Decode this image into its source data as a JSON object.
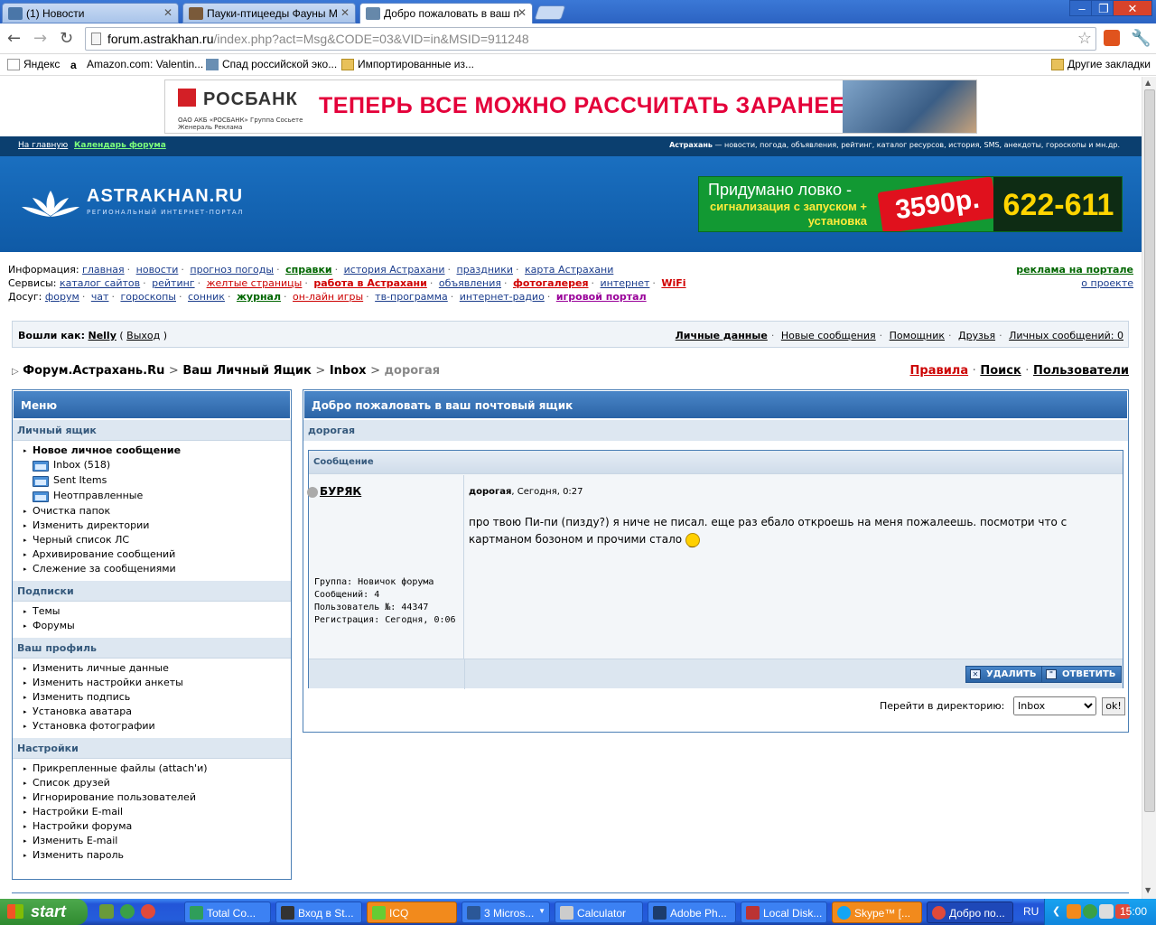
{
  "browser": {
    "tabs": [
      {
        "label": "(1) Новости",
        "icon_color": "#4a76a8"
      },
      {
        "label": "Пауки-птицееды Фауны М",
        "icon_color": "#7a5a3a"
      },
      {
        "label": "Добро пожаловать в ваш п",
        "icon_color": "#6688aa"
      }
    ],
    "url_host": "forum.astrakhan.ru",
    "url_path": "/index.php?act=Msg&CODE=03&VID=in&MSID=911248",
    "bookmarks": [
      "Яндекс",
      "Amazon.com: Valentin...",
      "Спад российской эко...",
      "Импортированные из...",
      "Другие закладки"
    ]
  },
  "banner_top": {
    "brand": "РОСБАНК",
    "small": "ОАО АКБ «РОСБАНК» Группа Сосьете Женераль  Реклама",
    "slogan": "ТЕПЕРЬ ВСЕ МОЖНО РАССЧИТАТЬ ЗАРАНЕЕ"
  },
  "topbar": {
    "home": "На главную",
    "calendar": "Календарь форума",
    "right_bold": "Астрахань",
    "right_text": " — новости, погода, объявления, рейтинг, каталог ресурсов, история, SMS, анекдоты, гороскопы и мн.др."
  },
  "header": {
    "site": "ASTRAKHAN.RU",
    "sub": "РЕГИОНАЛЬНЫЙ ИНТЕРНЕТ-ПОРТАЛ",
    "ad_line1": "Придумано ловко -",
    "ad_line2": "сигнализация с запуском + установка",
    "ad_price": "3590р.",
    "ad_phone": "622-611"
  },
  "links": {
    "info_label": "Информация:",
    "info": [
      "главная",
      "новости",
      "прогноз погоды",
      "справки",
      "история Астрахани",
      "праздники",
      "карта Астрахани"
    ],
    "services_label": "Сервисы:",
    "services": [
      "каталог сайтов",
      "рейтинг",
      "желтые страницы",
      "работа в Астрахани",
      "объявления",
      "фотогалерея",
      "интернет",
      "WiFi"
    ],
    "leisure_label": "Досуг:",
    "leisure": [
      "форум",
      "чат",
      "гороскопы",
      "сонник",
      "журнал",
      "он-лайн игры",
      "тв-программа",
      "интернет-радио",
      "игровой портал"
    ],
    "ad_on_portal": "реклама на портале",
    "about": "о проекте"
  },
  "userbar": {
    "logged_as": "Вошли как:",
    "user": "Nelly",
    "logout": "Выход",
    "right": [
      "Личные данные",
      "Новые сообщения",
      "Помощник",
      "Друзья",
      "Личных сообщений: 0"
    ]
  },
  "breadcrumb": [
    "Форум.Астрахань.Ru",
    "Ваш Личный Ящик",
    "Inbox",
    "дорогая"
  ],
  "toplinks": [
    "Правила",
    "Поиск",
    "Пользователи"
  ],
  "menu": {
    "title": "Меню",
    "sections": [
      {
        "title": "Личный ящик",
        "items": [
          "Новое личное сообщение",
          "Inbox (518)",
          "Sent Items",
          "Неотправленные",
          "Очистка папок",
          "Изменить директории",
          "Черный список ЛС",
          "Архивирование сообщений",
          "Слежение за сообщениями"
        ]
      },
      {
        "title": "Подписки",
        "items": [
          "Темы",
          "Форумы"
        ]
      },
      {
        "title": "Ваш профиль",
        "items": [
          "Изменить личные данные",
          "Изменить настройки анкеты",
          "Изменить подпись",
          "Установка аватара",
          "Установка фотографии"
        ]
      },
      {
        "title": "Настройки",
        "items": [
          "Прикрепленные файлы (attach'и)",
          "Список друзей",
          "Игнорирование пользователей",
          "Настройки E-mail",
          "Настройки форума",
          "Изменить E-mail",
          "Изменить пароль"
        ]
      }
    ]
  },
  "message": {
    "panel_title": "Добро пожаловать в ваш почтовый ящик",
    "subject": "дорогая",
    "box_title": "Сообщение",
    "author": "БУРЯК",
    "meta_subject": "дорогая",
    "meta_time": ", Сегодня, 0:27",
    "body": "про твою Пи-пи (пизду?) я ниче не писал. еще раз ебало откроешь на меня пожалеешь. посмотри что с картманом бозоном и прочими стало",
    "info": [
      "Группа: Новичок форума",
      "Сообщений: 4",
      "Пользователь №: 44347",
      "Регистрация: Сегодня, 0:06"
    ],
    "delete_btn": "УДАЛИТЬ",
    "reply_btn": "ОТВЕТИТЬ"
  },
  "jump": {
    "label": "Перейти в директорию:",
    "selected": "Inbox",
    "ok": "ok!"
  },
  "taskbar": {
    "start": "start",
    "tasks": [
      "Total Co...",
      "Вход в St...",
      "ICQ",
      "3 Micros...",
      "Calculator",
      "Adobe Ph...",
      "Local Disk...",
      "Skype™ [...",
      "Добро по..."
    ],
    "lang": "RU",
    "clock": "15:00"
  }
}
